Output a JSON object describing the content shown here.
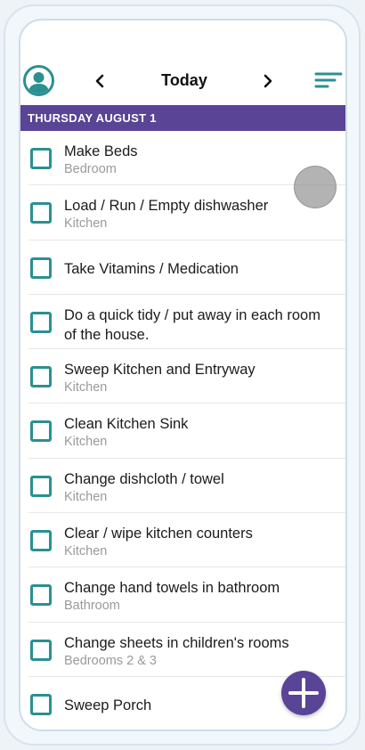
{
  "header": {
    "title": "Today",
    "prev_icon": "chevron-left-icon",
    "next_icon": "chevron-right-icon",
    "sort_icon": "sort-lines-icon",
    "avatar_icon": "user-avatar-icon"
  },
  "date_banner": "THURSDAY AUGUST 1",
  "tasks": [
    {
      "name": "Make Beds",
      "location": "Bedroom"
    },
    {
      "name": "Load / Run / Empty dishwasher",
      "location": "Kitchen"
    },
    {
      "name": "Take Vitamins / Medication",
      "location": ""
    },
    {
      "name": "Do a quick tidy / put away in each room of the house.",
      "location": ""
    },
    {
      "name": "Sweep Kitchen and Entryway",
      "location": "Kitchen"
    },
    {
      "name": "Clean Kitchen Sink",
      "location": "Kitchen"
    },
    {
      "name": "Change dishcloth / towel",
      "location": "Kitchen"
    },
    {
      "name": "Clear / wipe kitchen counters",
      "location": "Kitchen"
    },
    {
      "name": "Change hand towels in bathroom",
      "location": "Bathroom"
    },
    {
      "name": "Change sheets in children's rooms",
      "location": "Bedrooms 2 & 3"
    },
    {
      "name": "Sweep Porch",
      "location": ""
    }
  ],
  "fab_icon": "plus-icon",
  "colors": {
    "accent_purple": "#5a4496",
    "accent_teal": "#2a9090"
  }
}
